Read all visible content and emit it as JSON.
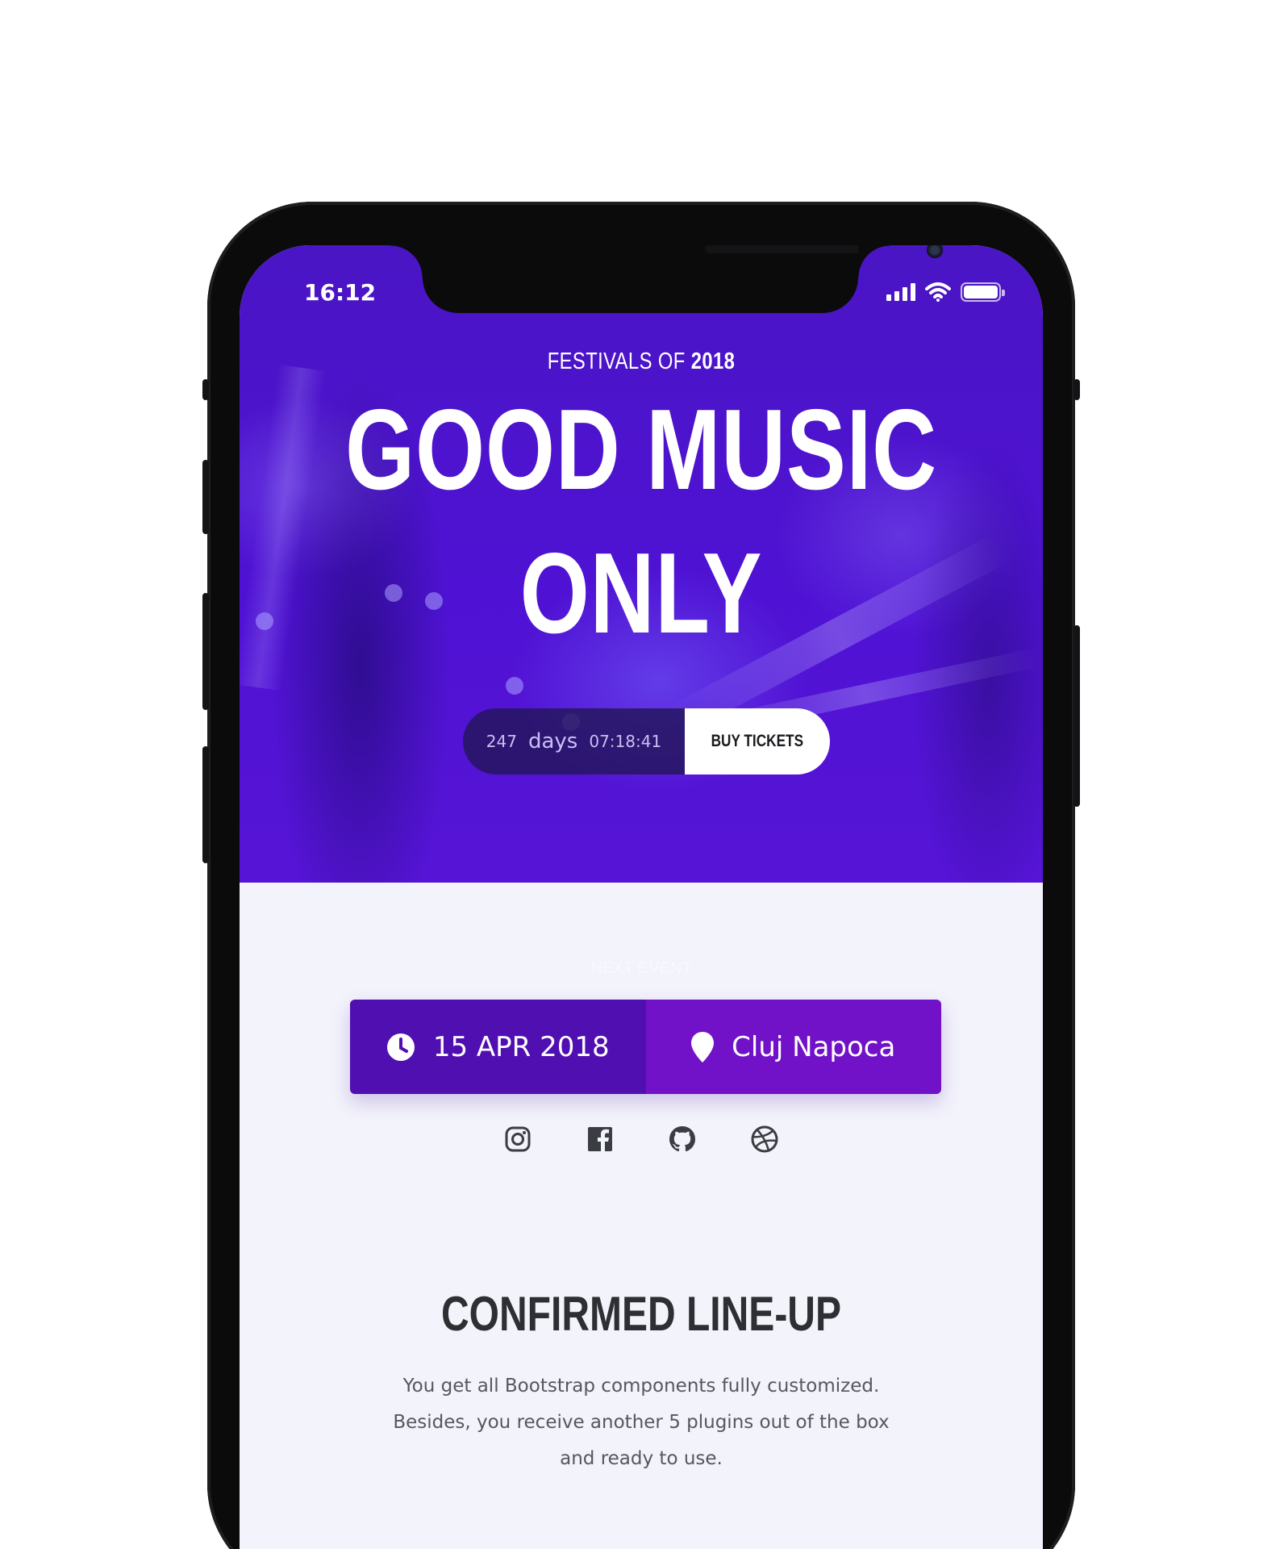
{
  "status_bar": {
    "time": "16:12"
  },
  "hero": {
    "subtitle_prefix": "FESTIVALS OF ",
    "subtitle_year": "2018",
    "headline_line1": "GOOD MUSIC",
    "headline_line2": "ONLY",
    "countdown": {
      "days_value": "247",
      "days_label": "days",
      "time": "07:18:41"
    },
    "buy_label": "BUY TICKETS"
  },
  "next_event": {
    "label": "NEXT EVENT",
    "date": "15 APR 2018",
    "location": "Cluj Napoca"
  },
  "socials": [
    "instagram-icon",
    "facebook-icon",
    "github-icon",
    "dribbble-icon"
  ],
  "lineup": {
    "title": "CONFIRMED LINE-UP",
    "description": "You get all Bootstrap components fully customized. Besides, you receive another 5 plugins out of the box and ready to use."
  },
  "colors": {
    "hero_purple": "#5014d4",
    "date_bg": "#500fb0",
    "location_bg": "#7112c8",
    "page_bg": "#f3f3fb"
  }
}
